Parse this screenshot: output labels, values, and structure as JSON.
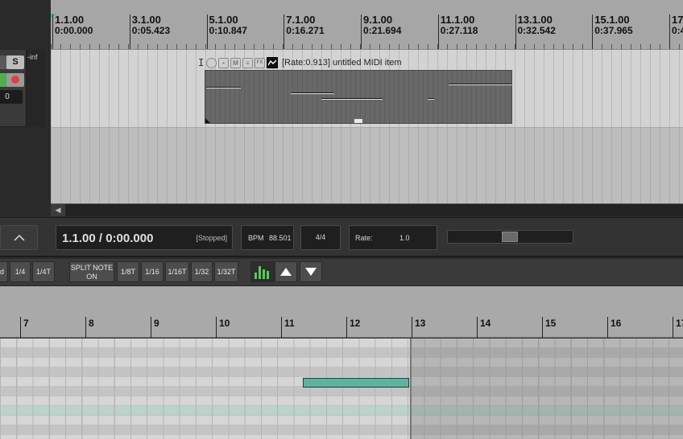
{
  "ruler": {
    "marks": [
      {
        "bar": "1.1.00",
        "time": "0:00.000"
      },
      {
        "bar": "3.1.00",
        "time": "0:05.423"
      },
      {
        "bar": "5.1.00",
        "time": "0:10.847"
      },
      {
        "bar": "7.1.00",
        "time": "0:16.271"
      },
      {
        "bar": "9.1.00",
        "time": "0:21.694"
      },
      {
        "bar": "11.1.00",
        "time": "0:27.118"
      },
      {
        "bar": "13.1.00",
        "time": "0:32.542"
      },
      {
        "bar": "15.1.00",
        "time": "0:37.965"
      },
      {
        "bar": "17",
        "time": "0:4"
      }
    ]
  },
  "track": {
    "solo_label": "S",
    "vol_readout": "-inf",
    "field_value": "0"
  },
  "item": {
    "title": "[Rate:0.913] untitled MIDI item",
    "icon_m": "M",
    "icon_fx": "FX"
  },
  "transport": {
    "position": "1.1.00 / 0:00.000",
    "state": "[Stopped]",
    "bpm_label": "BPM",
    "bpm_value": "88.501",
    "time_sig": "4/4",
    "rate_label": "Rate:",
    "rate_value": "1.0"
  },
  "grid_toolbar": {
    "buttons": [
      {
        "label": "d"
      },
      {
        "label": "1/4"
      },
      {
        "label": "1/4T"
      },
      {
        "label": "SPLIT NOTE ON"
      },
      {
        "label": "1/8T"
      },
      {
        "label": "1/16"
      },
      {
        "label": "1/16T"
      },
      {
        "label": "1/32"
      },
      {
        "label": "1/32T"
      }
    ]
  },
  "editor_ruler": {
    "labels": [
      "7",
      "8",
      "9",
      "10",
      "11",
      "12",
      "13",
      "14",
      "15",
      "16",
      "17"
    ]
  },
  "colors": {
    "note": "#5eb3a0",
    "playhead": "#3bbf8a",
    "record": "#e04040"
  }
}
